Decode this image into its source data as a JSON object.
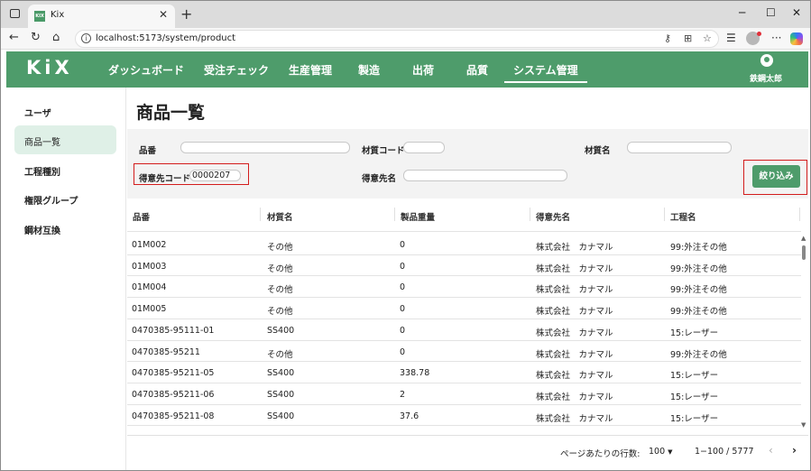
{
  "browser": {
    "tab_title": "Kix",
    "tab_favicon": "KIX",
    "url": "localhost:5173/system/product",
    "icons": [
      "tabs-icon",
      "close-icon",
      "new-tab-icon",
      "minimize-icon",
      "maximize-icon",
      "window-close-icon",
      "back-icon",
      "refresh-icon",
      "home-icon",
      "info-icon",
      "key-icon",
      "reader-icon",
      "favorite-icon",
      "favorites-icon",
      "more-icon",
      "copilot-icon"
    ]
  },
  "app": {
    "logo": "KiX",
    "nav": [
      "ダッシュボード",
      "受注チェック",
      "生産管理",
      "製造",
      "出荷",
      "品質",
      "システム管理"
    ],
    "active_nav": "システム管理",
    "user_name": "鉄鋼太郎",
    "brand_color": "#4e9c6b"
  },
  "sidebar": {
    "items": [
      "ユーザ",
      "商品一覧",
      "工程種別",
      "権限グループ",
      "鋼材互換"
    ],
    "active": "商品一覧"
  },
  "page": {
    "title": "商品一覧"
  },
  "filters": {
    "product_no_label": "品番",
    "product_no_value": "",
    "material_code_label": "材質コード",
    "material_code_value": "",
    "material_name_label": "材質名",
    "material_name_value": "",
    "customer_code_label": "得意先コード",
    "customer_code_value": "0000207",
    "customer_name_label": "得意先名",
    "customer_name_value": "",
    "filter_button": "絞り込み"
  },
  "table": {
    "columns": [
      "品番",
      "材質名",
      "製品重量",
      "得意先名",
      "工程名"
    ],
    "rows": [
      [
        "01M002",
        "その他",
        "0",
        "株式会社　カナマル",
        "99:外注その他"
      ],
      [
        "01M003",
        "その他",
        "0",
        "株式会社　カナマル",
        "99:外注その他"
      ],
      [
        "01M004",
        "その他",
        "0",
        "株式会社　カナマル",
        "99:外注その他"
      ],
      [
        "01M005",
        "その他",
        "0",
        "株式会社　カナマル",
        "99:外注その他"
      ],
      [
        "0470385-95111-01",
        "SS400",
        "0",
        "株式会社　カナマル",
        "15:レーザー"
      ],
      [
        "0470385-95211",
        "その他",
        "0",
        "株式会社　カナマル",
        "99:外注その他"
      ],
      [
        "0470385-95211-05",
        "SS400",
        "338.78",
        "株式会社　カナマル",
        "15:レーザー"
      ],
      [
        "0470385-95211-06",
        "SS400",
        "2",
        "株式会社　カナマル",
        "15:レーザー"
      ],
      [
        "0470385-95211-08",
        "SS400",
        "37.6",
        "株式会社　カナマル",
        "15:レーザー"
      ]
    ]
  },
  "pagination": {
    "rows_per_page_label": "ページあたりの行数:",
    "rows_per_page": "100",
    "range": "1−100 / 5777"
  }
}
